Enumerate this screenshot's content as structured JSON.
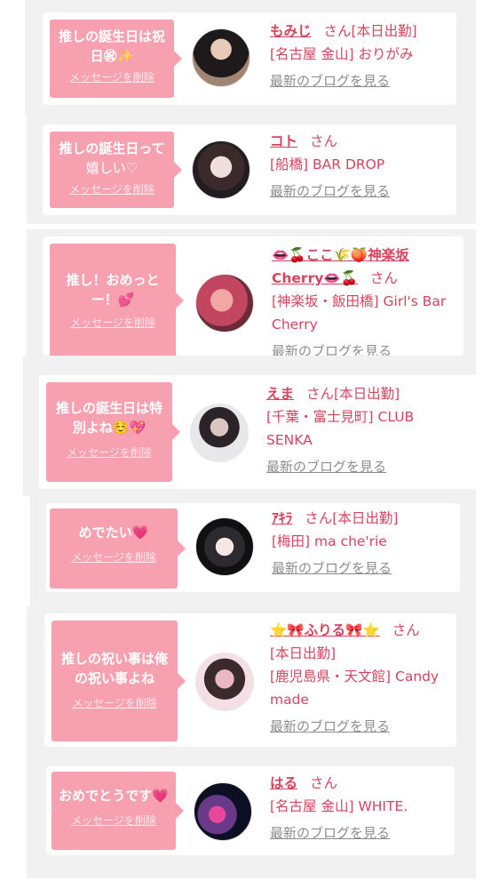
{
  "cards": [
    {
      "message": "推しの誕生日は祝日🈵✨",
      "message_lines": [
        "推しの誕生日は祝",
        "日㊗✨"
      ],
      "delete_label": "メッセージを削除",
      "name": "もみじ",
      "san": "さん",
      "info_lines": [
        "[本日出勤]",
        "[名古屋 金山] おりがみ"
      ],
      "blog_label": "最新のブログを見る",
      "avatar_colors": [
        "#1e1a1c",
        "#e8c9b8",
        "#a08574"
      ]
    },
    {
      "message_lines": [
        "推しの誕生日って",
        "嬉しい♡"
      ],
      "delete_label": "メッセージを削除",
      "name": "コト",
      "san": "さん",
      "info_lines": [
        "[船橋] BAR DROP"
      ],
      "blog_label": "最新のブログを見る",
      "avatar_colors": [
        "#221d20",
        "#f1dede",
        "#3b2a2b"
      ]
    },
    {
      "message_lines": [
        "推し！おめっと",
        "ー！💕"
      ],
      "delete_label": "メッセージを削除",
      "name_lines": [
        "👄🍒ここ🌾🍑神楽坂",
        "Cherry👄🍒"
      ],
      "san": "さん",
      "info_lines": [
        "[神楽坂・飯田橋] Girl's Bar",
        "Cherry"
      ],
      "blog_label": "最新のブログを見る",
      "avatar_colors": [
        "#c2465f",
        "#f0a7a6",
        "#6b2b38"
      ]
    },
    {
      "message_lines": [
        "推しの誕生日は特",
        "別よね☺️💖"
      ],
      "delete_label": "メッセージを削除",
      "name": "えま",
      "san": "さん",
      "info_lines_inline": "[本日出勤]",
      "info_lines": [
        "[千葉・富士見町] CLUB",
        "SENKA"
      ],
      "blog_label": "最新のブログを見る",
      "avatar_colors": [
        "#e8e8ea",
        "#2a2328",
        "#d9c6bf"
      ]
    },
    {
      "message_lines": [
        "めでたい💗"
      ],
      "delete_label": "メッセージを削除",
      "name": "ｱｷﾗ",
      "san": "さん",
      "info_lines_inline": "[本日出勤]",
      "info_lines": [
        "[梅田] ma che'rie"
      ],
      "blog_label": "最新のブログを見る",
      "avatar_colors": [
        "#101012",
        "#f4e7e6",
        "#2d2a2f"
      ]
    },
    {
      "message_lines": [
        "推しの祝い事は俺",
        "の祝い事よね"
      ],
      "delete_label": "メッセージを削除",
      "name": "⭐🎀ふりる🎀⭐",
      "san": "さん",
      "info_lines": [
        "[本日出勤]",
        "[鹿児島県・天文館] Candy",
        "made"
      ],
      "blog_label": "最新のブログを見る",
      "avatar_colors": [
        "#f3dfe4",
        "#3a2a2e",
        "#e9b8c3"
      ]
    },
    {
      "message_lines": [
        "おめでとうです💗"
      ],
      "delete_label": "メッセージを削除",
      "name": "はる",
      "san": "さん",
      "info_lines": [
        "[名古屋 金山] WHITE."
      ],
      "blog_label": "最新のブログを見る",
      "avatar_colors": [
        "#0d1022",
        "#6a3a8a",
        "#e8479b"
      ]
    }
  ]
}
